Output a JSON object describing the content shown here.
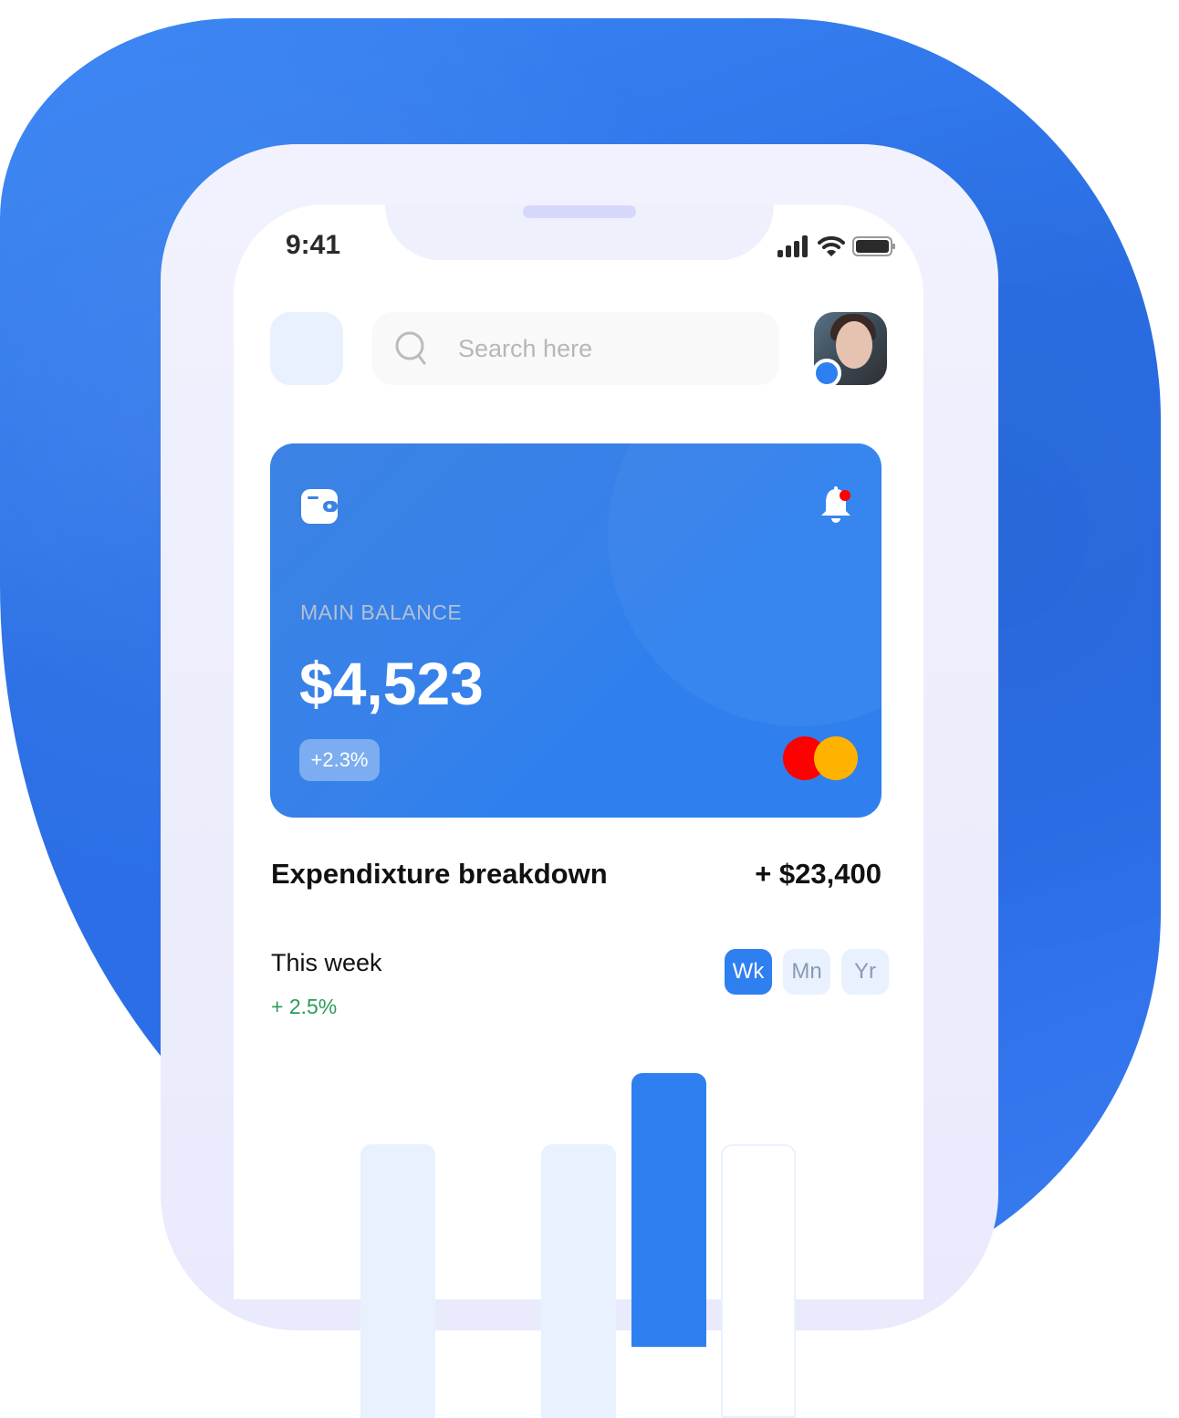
{
  "status_bar": {
    "time": "9:41"
  },
  "search": {
    "placeholder": "Search here"
  },
  "card": {
    "label": "MAIN BALANCE",
    "balance": "$4,523",
    "change": "+2.3%"
  },
  "breakdown": {
    "title": "Expendixture breakdown",
    "total": "+ $23,400",
    "period": "This week",
    "change": "+ 2.5%",
    "tabs": [
      {
        "label": "Wk",
        "active": true
      },
      {
        "label": "Mn",
        "active": false
      },
      {
        "label": "Yr",
        "active": false
      }
    ]
  },
  "colors": {
    "accent": "#2e7ff0",
    "positive": "#2a9d55",
    "mastercard_red": "#ff0000",
    "mastercard_yellow": "#ffb300"
  }
}
